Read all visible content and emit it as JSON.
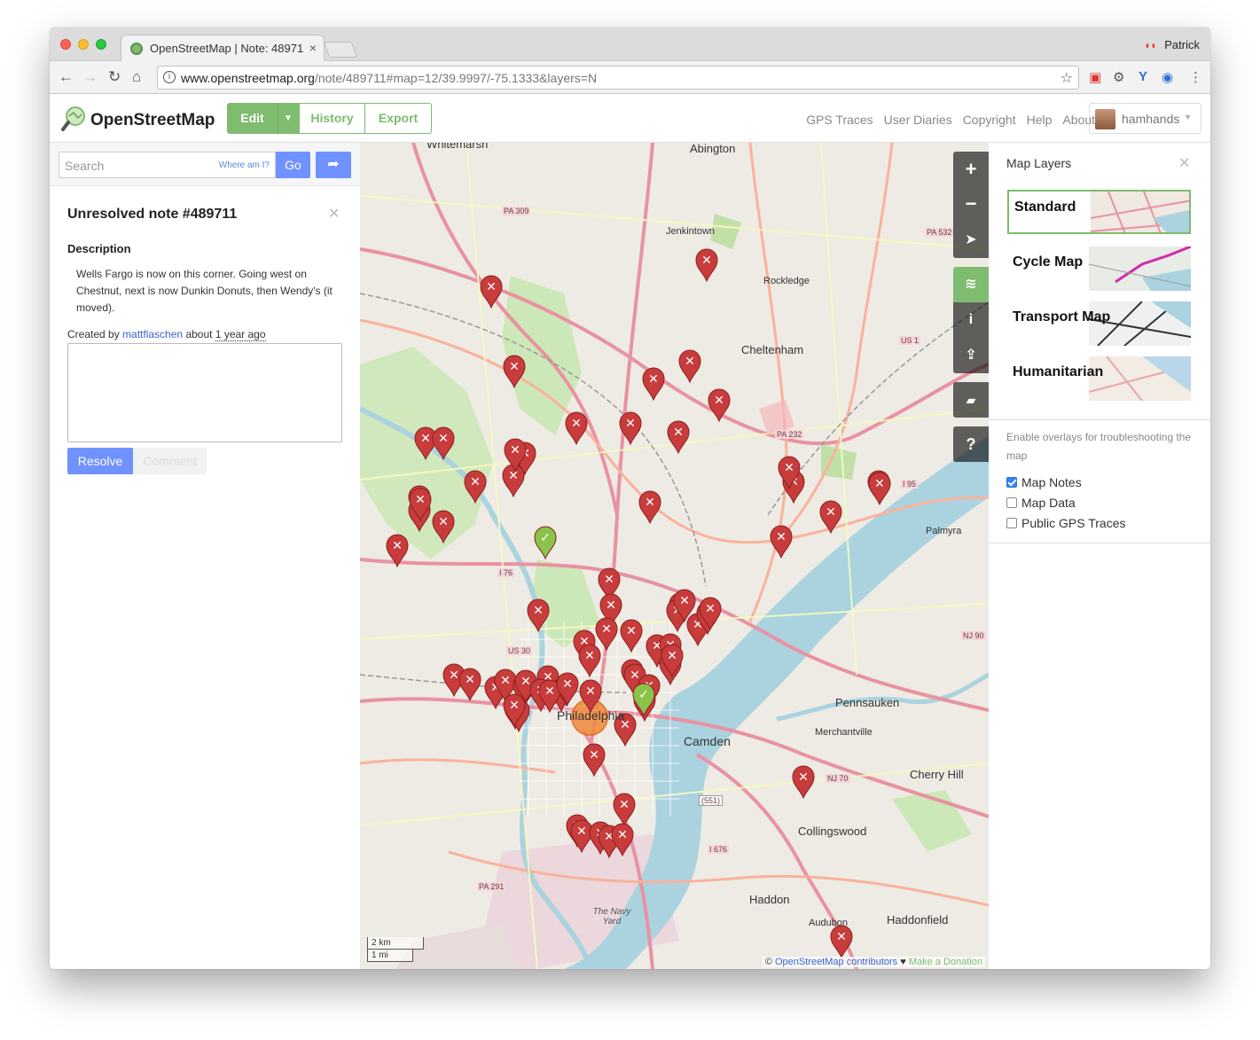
{
  "browser": {
    "tab_title": "OpenStreetMap | Note: 48971",
    "profile_name": "Patrick",
    "url_host": "www.openstreetmap.org",
    "url_path": "/note/489711#map=12/39.9997/-75.1333&layers=N"
  },
  "header": {
    "site_title": "OpenStreetMap",
    "edit": "Edit",
    "history": "History",
    "export": "Export",
    "links": [
      "GPS Traces",
      "User Diaries",
      "Copyright",
      "Help",
      "About"
    ],
    "username": "hamhands"
  },
  "sidebar": {
    "search_placeholder": "Search",
    "where_am_i": "Where am I?",
    "go": "Go",
    "note_title": "Unresolved note #489711",
    "description_heading": "Description",
    "description": "Wells Fargo is now on this corner. Going west on Chestnut, next is now Dunkin Donuts, then Wendy's (it moved).",
    "created_prefix": "Created by",
    "created_user": "mattflaschen",
    "created_about": "about",
    "created_ago": "1 year ago",
    "resolve": "Resolve",
    "comment": "Comment"
  },
  "map": {
    "place_labels": [
      {
        "text": "Whitemarsh"
      },
      {
        "text": "Abington"
      },
      {
        "text": "Jenkintown"
      },
      {
        "text": "Rockledge"
      },
      {
        "text": "Cheltenham"
      },
      {
        "text": "Palmyra"
      },
      {
        "text": "Philadelphia"
      },
      {
        "text": "Camden"
      },
      {
        "text": "Pennsauken"
      },
      {
        "text": "Merchantville"
      },
      {
        "text": "Cherry Hill"
      },
      {
        "text": "Collingswood"
      },
      {
        "text": "Haddon"
      },
      {
        "text": "Haddonfield"
      },
      {
        "text": "Audubon"
      },
      {
        "text": "The Navy Yard"
      }
    ],
    "road_labels": [
      "PA 309",
      "PA 532",
      "PA 232",
      "US 1",
      "I 95",
      "I 76",
      "US 30",
      "NJ 70",
      "NJ 90",
      "I 676",
      "PA 291",
      "(551)"
    ],
    "scale_km": "2 km",
    "scale_mi": "1 mi",
    "attribution_prefix": "©",
    "attribution_link": "OpenStreetMap contributors",
    "attribution_heart": "♥",
    "attribution_donate": "Make a Donation",
    "controls": [
      "zoom-in",
      "zoom-out",
      "locate",
      "layers",
      "info",
      "share",
      "note",
      "query"
    ],
    "note_count": 75
  },
  "layers_panel": {
    "title": "Map Layers",
    "tiles": [
      {
        "label": "Standard",
        "selected": true
      },
      {
        "label": "Cycle Map",
        "selected": false
      },
      {
        "label": "Transport Map",
        "selected": false
      },
      {
        "label": "Humanitarian",
        "selected": false
      }
    ],
    "overlay_note": "Enable overlays for troubleshooting the map",
    "overlays": [
      {
        "label": "Map Notes",
        "checked": true
      },
      {
        "label": "Map Data",
        "checked": false
      },
      {
        "label": "Public GPS Traces",
        "checked": false
      }
    ]
  },
  "colors": {
    "osm_green": "#7ebc6f",
    "button_blue": "#7092ff",
    "note_red": "#c83c3c"
  }
}
